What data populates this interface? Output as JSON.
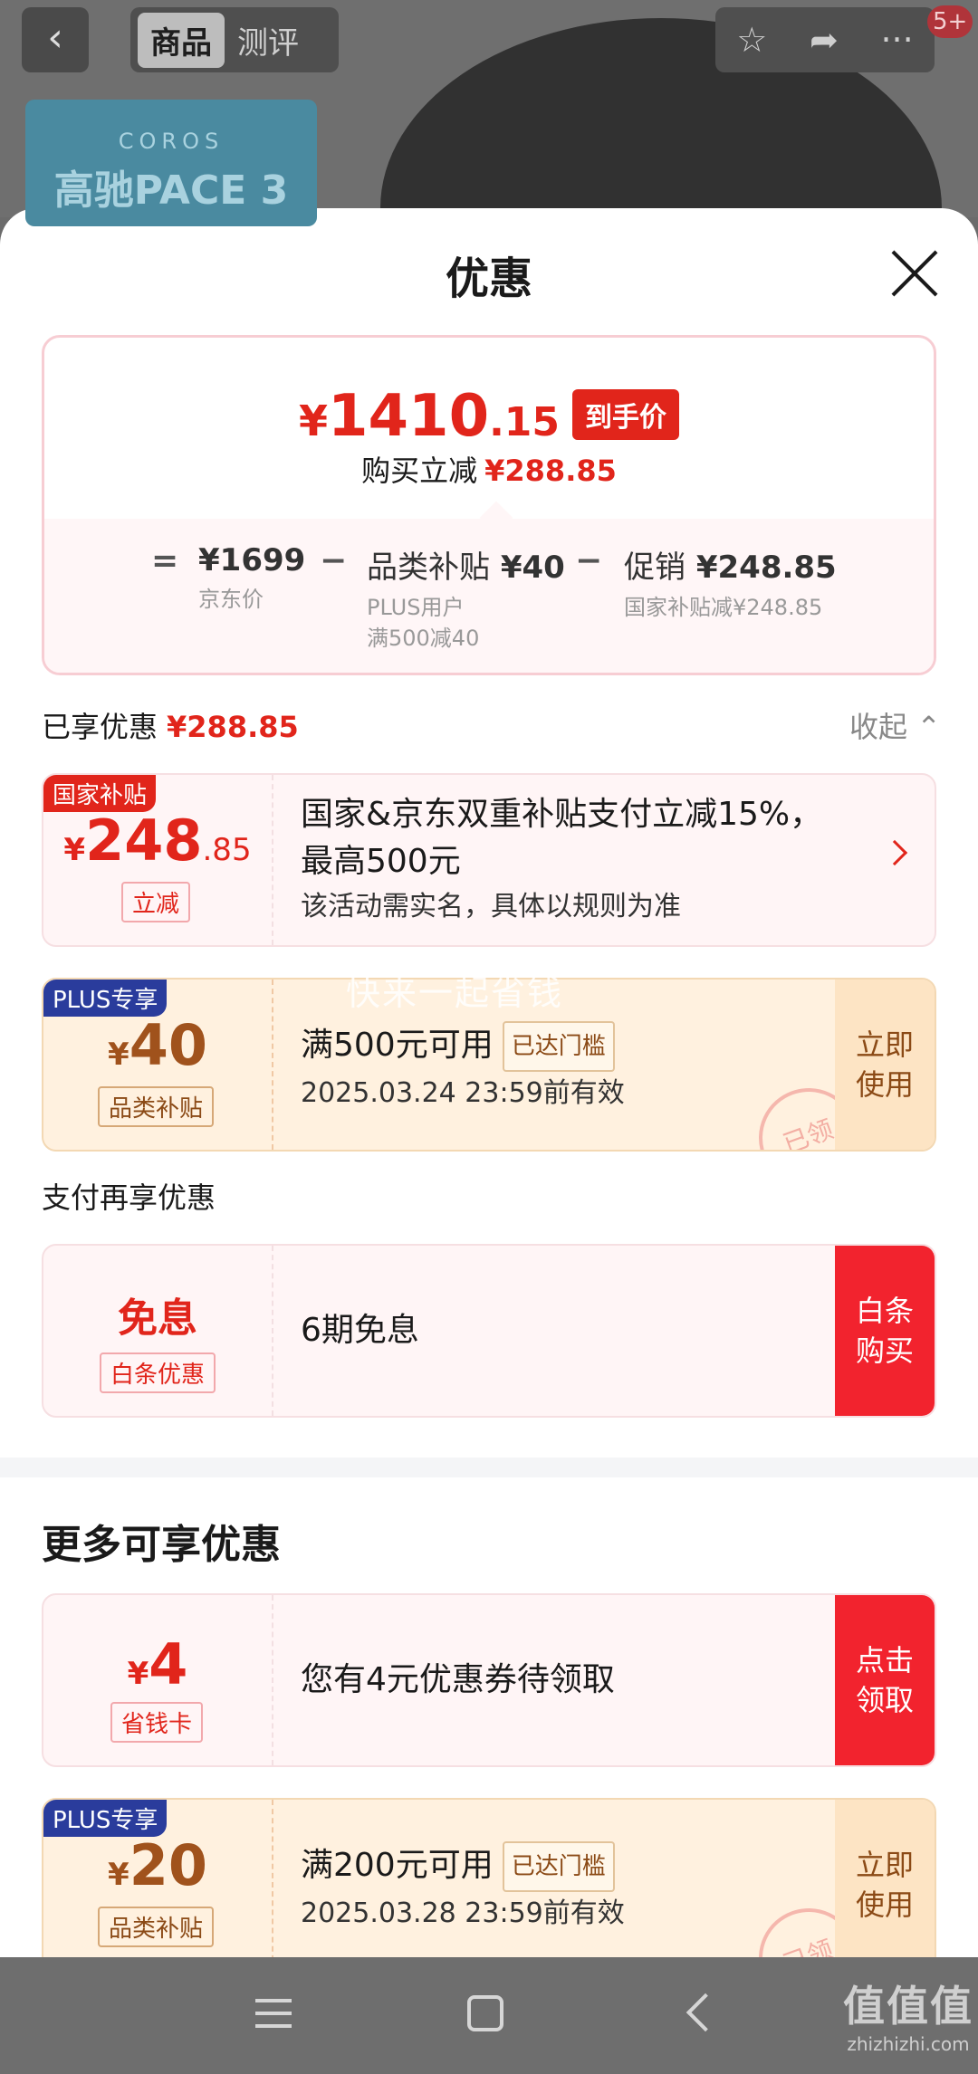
{
  "header": {
    "back_icon": "chevron-left-icon",
    "tabs": [
      {
        "label": "商品",
        "active": true
      },
      {
        "label": "测评",
        "active": false
      }
    ],
    "actions": [
      "star-icon",
      "share-icon",
      "more-icon"
    ],
    "badge": "5+",
    "brand_logo": "COROS",
    "brand_product": "高驰PACE 3"
  },
  "sheet": {
    "title": "优惠",
    "close_icon": "close-icon"
  },
  "price_summary": {
    "final_price_yen": "¥",
    "final_price_int": "1410",
    "final_price_dec": ".15",
    "final_tag": "到手价",
    "reduce_label": "购买立减",
    "reduce_amount": "¥288.85",
    "breakdown": {
      "eq": "=",
      "jd_price": "¥1699",
      "jd_label": "京东价",
      "minus1": "−",
      "category_label": "品类补贴",
      "category_amount": "¥40",
      "category_sub1": "PLUS用户",
      "category_sub2": "满500减40",
      "minus2": "−",
      "promo_label": "促销",
      "promo_amount": "¥248.85",
      "promo_sub": "国家补贴减¥248.85"
    }
  },
  "enjoyed": {
    "label": "已享优惠",
    "amount": "¥288.85",
    "collapse_label": "收起"
  },
  "coupons": {
    "national": {
      "tag": "国家补贴",
      "yen": "¥",
      "amount_int": "248",
      "amount_dec": ".85",
      "sub": "立减",
      "title_line1": "国家&京东双重补贴支付立减15%，",
      "title_line2": "最高500元",
      "desc": "该活动需实名，具体以规则为准"
    },
    "plus40": {
      "tag": "PLUS专享",
      "yen": "¥",
      "amount": "40",
      "sub": "品类补贴",
      "title": "满500元可用",
      "chip": "已达门槛",
      "validity": "2025.03.24 23:59前有效",
      "action": "立即使用",
      "stamp": "已领"
    },
    "watermark": "快来一起省钱"
  },
  "payment": {
    "section_label": "支付再享优惠",
    "title": "免息",
    "sub": "白条优惠",
    "desc": "6期免息",
    "action": "白条购买"
  },
  "more": {
    "title": "更多可享优惠",
    "card4": {
      "yen": "¥",
      "amount": "4",
      "sub": "省钱卡",
      "desc": "您有4元优惠券待领取",
      "action": "点击领取"
    },
    "plus20": {
      "tag": "PLUS专享",
      "yen": "¥",
      "amount": "20",
      "sub": "品类补贴",
      "title": "满200元可用",
      "chip": "已达门槛",
      "validity": "2025.03.28 23:59前有效",
      "action": "立即使用",
      "stamp": "已领"
    }
  },
  "navbar": {
    "menu_icon": "menu-icon",
    "home_icon": "home-icon",
    "back_icon": "back-icon",
    "logo_main": "值值值",
    "logo_sub": "zhizhizhi.com"
  },
  "colors": {
    "accent_red": "#e1251b",
    "plus_blue": "#2a3c9c",
    "gold_bg": "#fff1df"
  }
}
